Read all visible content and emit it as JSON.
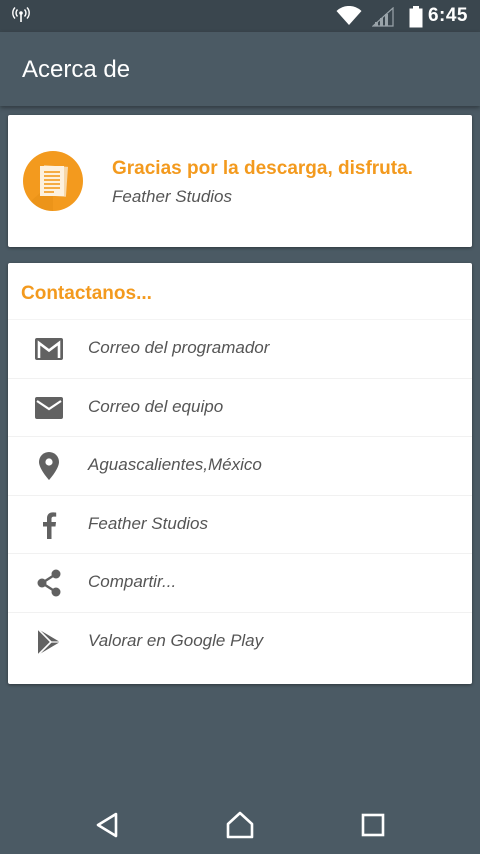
{
  "status_bar": {
    "time": "6:45",
    "icons": [
      "antenna-icon",
      "wifi-icon",
      "signal-icon",
      "battery-icon"
    ]
  },
  "app_bar": {
    "title": "Acerca de"
  },
  "welcome_card": {
    "icon": "document-icon",
    "title": "Gracias por la descarga, disfruta.",
    "subtitle": "Feather Studios"
  },
  "contact_card": {
    "header": "Contactanos...",
    "items": [
      {
        "icon": "gmail-icon",
        "label": "Correo del programador"
      },
      {
        "icon": "mail-icon",
        "label": "Correo del equipo"
      },
      {
        "icon": "location-pin-icon",
        "label": "Aguascalientes,México"
      },
      {
        "icon": "facebook-icon",
        "label": "Feather Studios"
      },
      {
        "icon": "share-icon",
        "label": "Compartir..."
      },
      {
        "icon": "google-play-icon",
        "label": "Valorar en Google Play"
      }
    ]
  },
  "nav_bar": {
    "buttons": [
      "back-icon",
      "home-icon",
      "recents-icon"
    ]
  },
  "colors": {
    "background": "#4b5a64",
    "status_bar": "#3a464e",
    "accent": "#f39a1e",
    "card": "#ffffff",
    "text_secondary": "#555555",
    "icon": "#616161"
  }
}
